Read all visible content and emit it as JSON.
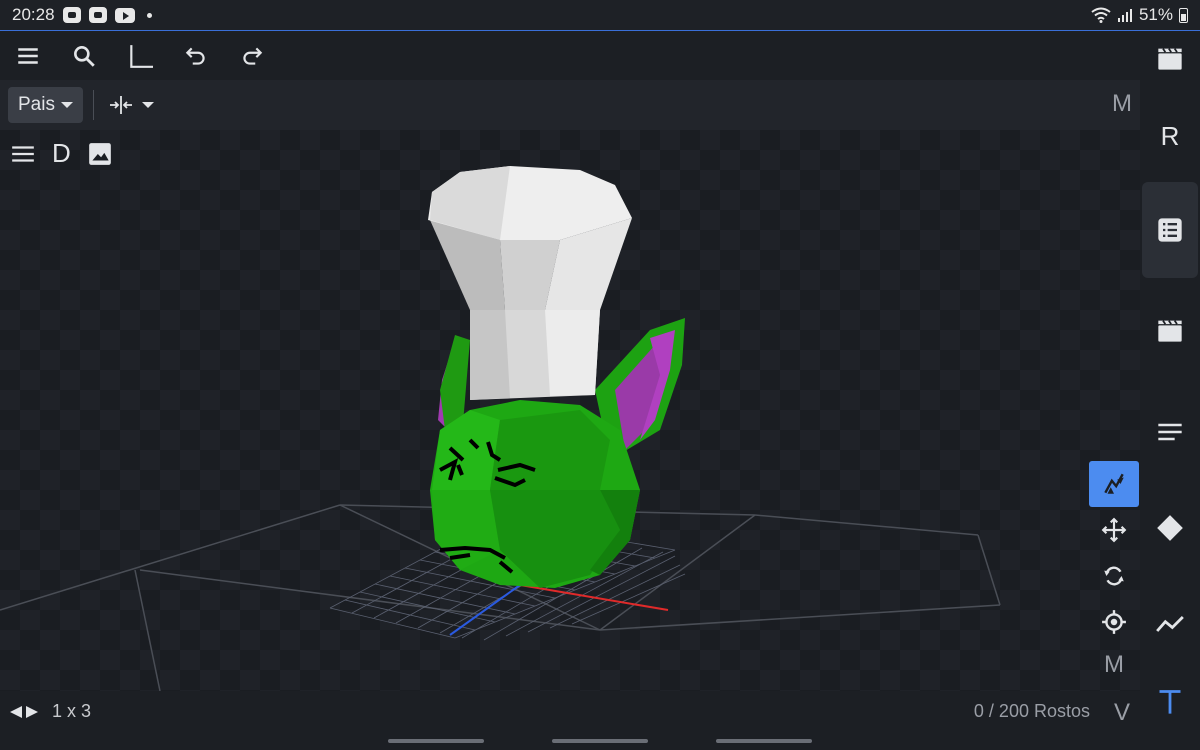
{
  "status_bar": {
    "time": "20:28",
    "battery": "51%"
  },
  "toolbar": {
    "items": [
      {
        "name": "menu-button",
        "icon": "menu-icon"
      },
      {
        "name": "search-button",
        "icon": "search-icon"
      },
      {
        "name": "corner-button",
        "icon": "corner-icon"
      },
      {
        "name": "undo-button",
        "icon": "undo-icon"
      },
      {
        "name": "redo-button",
        "icon": "redo-icon"
      }
    ]
  },
  "subbar": {
    "pivot_label": "Pais",
    "cut_label": "M"
  },
  "viewport": {
    "tool_d_label": "D",
    "model_colors": {
      "skin": "#22b014",
      "ear_inner": "#a03ab0",
      "hat": "#e0e0e0",
      "grid_x": "#e02a2a",
      "grid_z": "#2a5ae0"
    }
  },
  "transform_tools": {
    "cut_label": "M"
  },
  "sidebar": {
    "r_label": "R",
    "accent": "#4c8cf0"
  },
  "bottom_bar": {
    "grid_size": "1 x 3",
    "faces": "0 / 200 Rostos",
    "cut_label": "V"
  }
}
